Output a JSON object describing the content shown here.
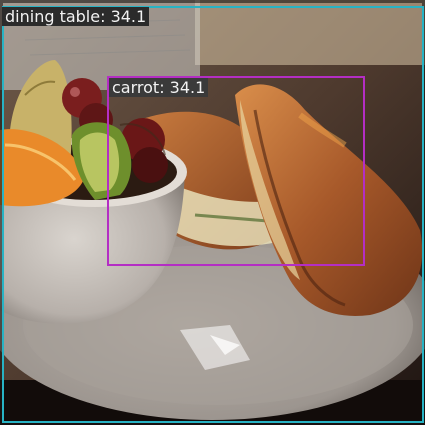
{
  "image": {
    "description_icon": "photo-icon"
  },
  "detections": [
    {
      "label": "dining table: 34.1",
      "color": "#27b3c4",
      "label_bg": "#2b2b2b"
    },
    {
      "label": "carrot: 34.1",
      "color": "#b42ec4",
      "label_bg": "#3a3a3a"
    }
  ]
}
